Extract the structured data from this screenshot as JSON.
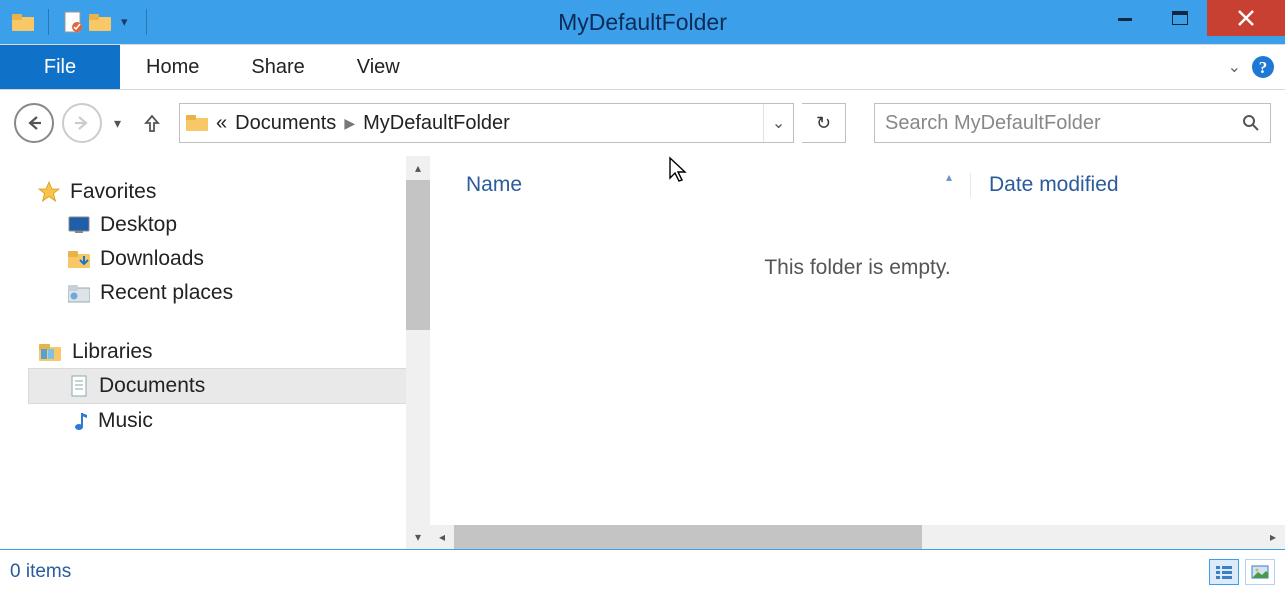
{
  "window": {
    "title": "MyDefaultFolder"
  },
  "ribbon": {
    "file_label": "File",
    "tabs": [
      "Home",
      "Share",
      "View"
    ]
  },
  "nav": {
    "breadcrumb": {
      "prefix": "«",
      "parent": "Documents",
      "current": "MyDefaultFolder"
    },
    "search_placeholder": "Search MyDefaultFolder"
  },
  "tree": {
    "favorites": {
      "label": "Favorites",
      "items": [
        "Desktop",
        "Downloads",
        "Recent places"
      ]
    },
    "libraries": {
      "label": "Libraries",
      "items": [
        "Documents",
        "Music"
      ]
    }
  },
  "columns": {
    "name": "Name",
    "date": "Date modified"
  },
  "empty_message": "This folder is empty.",
  "status": {
    "count_label": "0 items"
  }
}
